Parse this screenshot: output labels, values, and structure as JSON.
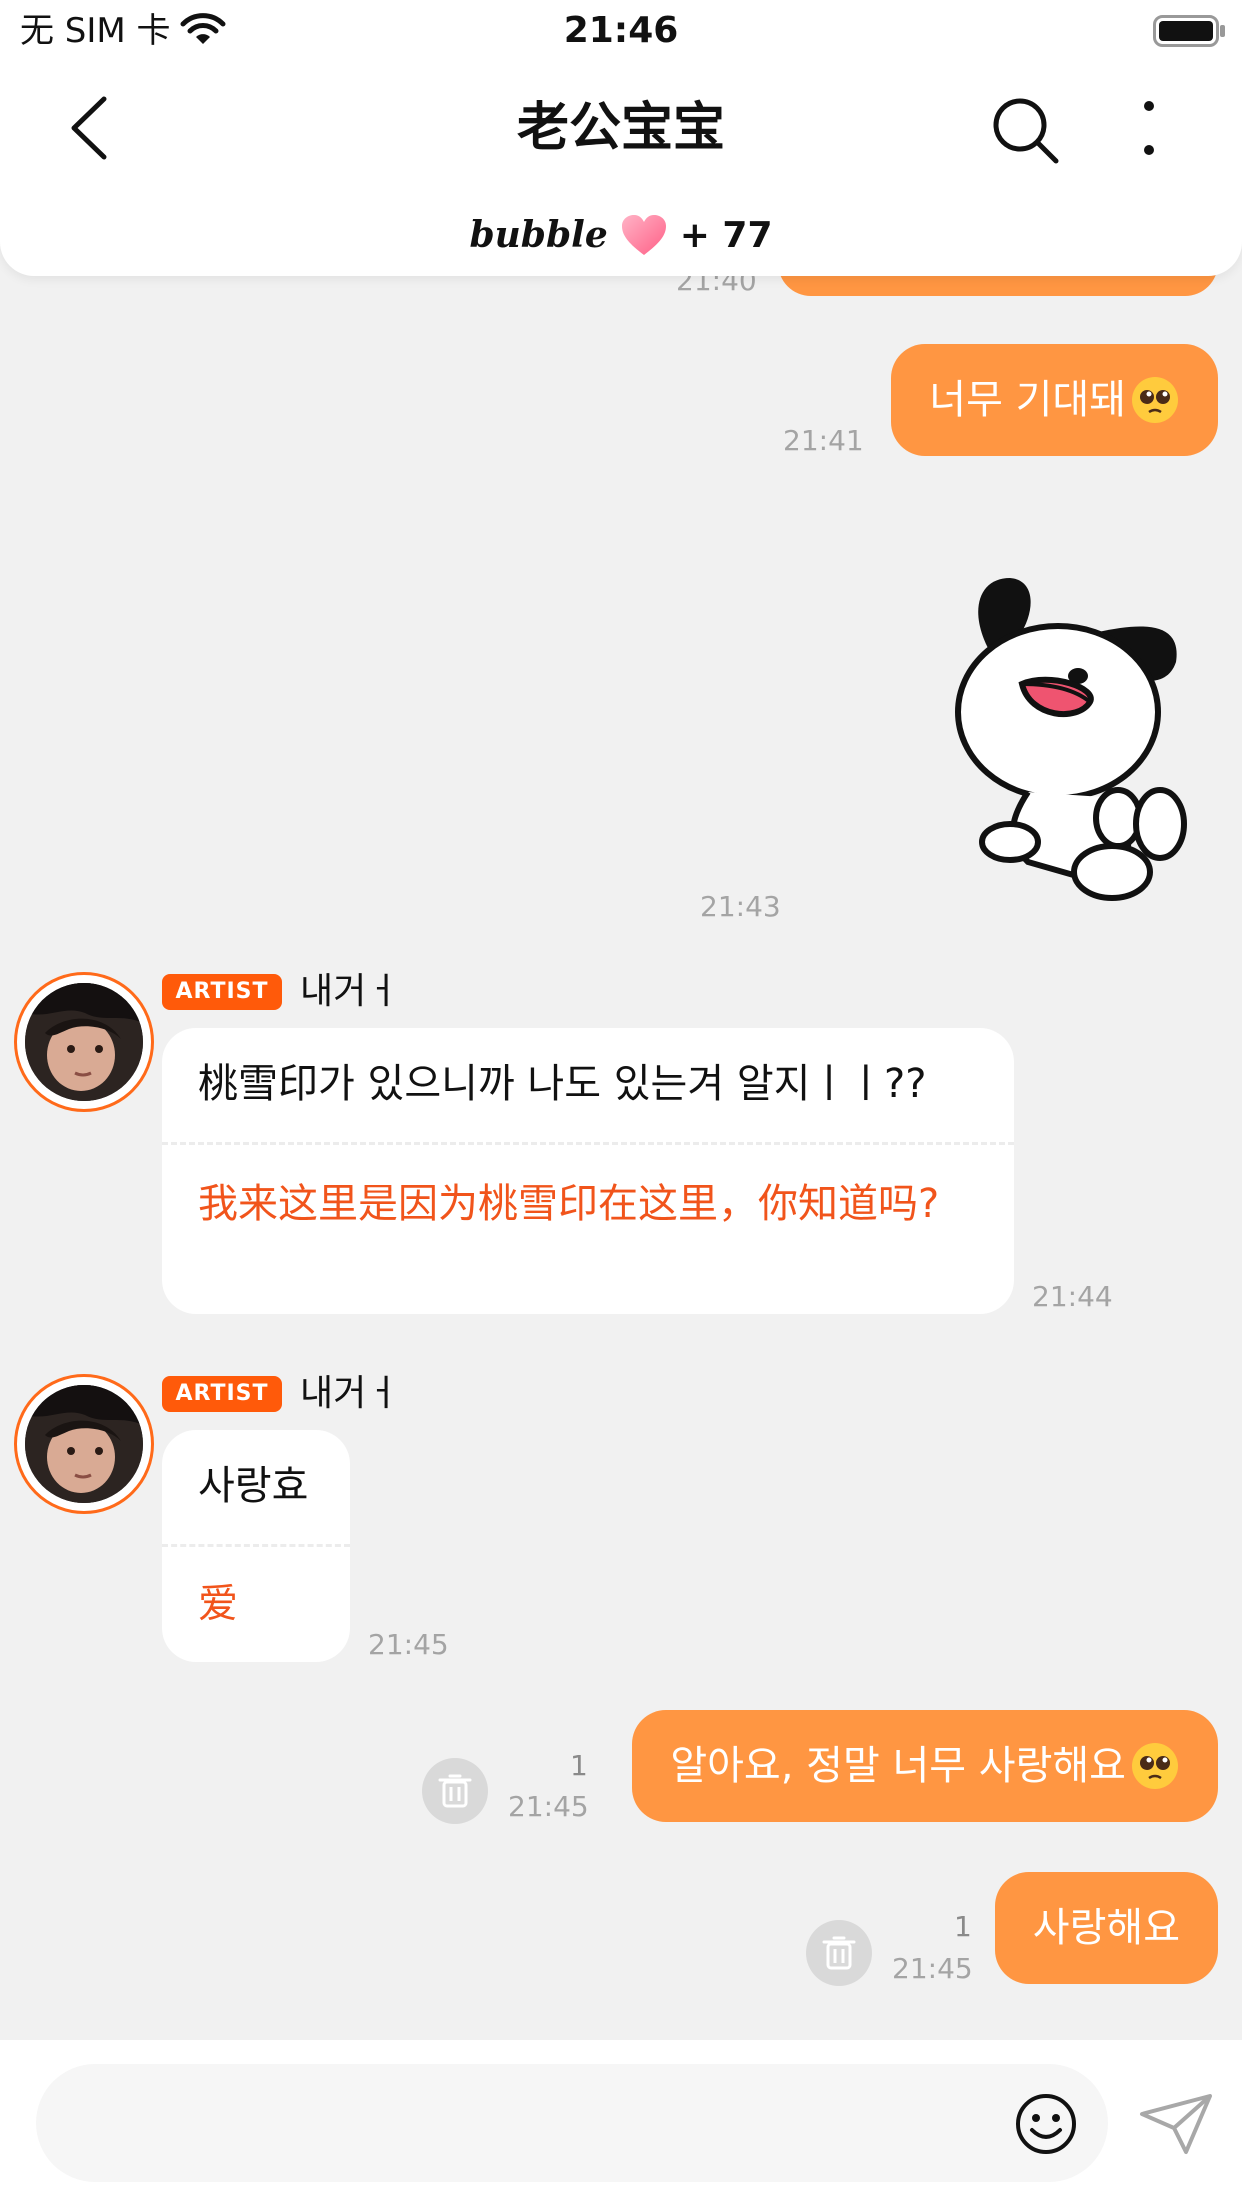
{
  "status_bar": {
    "carrier": "无 SIM 卡",
    "time": "21:46"
  },
  "header": {
    "title": "老公宝宝",
    "bubble_logo": "bubble",
    "bubble_count": "+ 77"
  },
  "messages": {
    "cut_time": "21:40",
    "out1": {
      "text": "너무 기대돼",
      "emoji": "pleading-face-emoji",
      "time": "21:41"
    },
    "sticker": {
      "name": "dog-sticker",
      "time": "21:43"
    },
    "in1": {
      "tag": "ARTIST",
      "sender": "내거ㅓ",
      "original": "桃雪印가 있으니까 나도 있는겨 알지ㅣㅣ??",
      "translation": "我来这里是因为桃雪印在这里，你知道吗?",
      "time": "21:44"
    },
    "in2": {
      "tag": "ARTIST",
      "sender": "내거ㅓ",
      "original": "사랑효",
      "translation": "爱",
      "time": "21:45"
    },
    "out2": {
      "text": "알아요, 정말 너무 사랑해요",
      "emoji": "pleading-face-emoji",
      "time": "21:45",
      "read": "1"
    },
    "out3": {
      "text": "사랑해요",
      "time": "21:45",
      "read": "1"
    }
  },
  "composer": {
    "input_value": "",
    "icons": [
      "smiley-icon",
      "send-icon"
    ]
  },
  "colors": {
    "accent": "#ff9642",
    "artist_tag": "#ff5a0a",
    "translation": "#f1541b",
    "background": "#f1f1f1"
  }
}
